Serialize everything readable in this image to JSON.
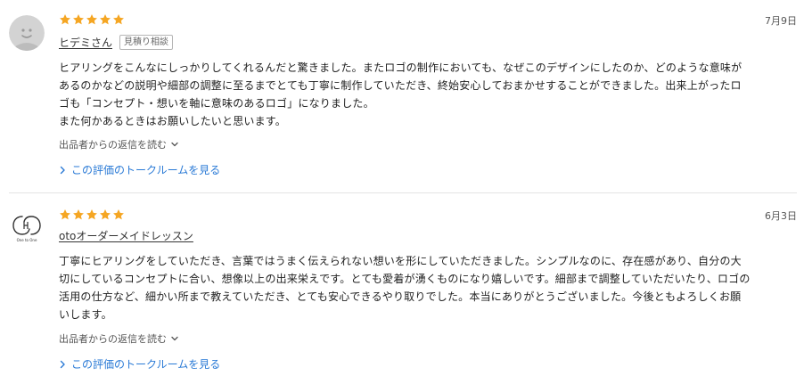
{
  "colors": {
    "star": "#f5a623",
    "link": "#2a7ad6",
    "divider": "#e4e4e4"
  },
  "reviews": [
    {
      "stars": 5,
      "date": "7月9日",
      "user_name": "ヒデミさん",
      "tag": "見積り相談",
      "avatar": "default-user-avatar-icon",
      "body_lines": [
        "ヒアリングをこんなにしっかりしてくれるんだと驚きました。またロゴの制作においても、なぜこのデザインにしたのか、どのような意味が",
        "あるのかなどの説明や細部の調整に至るまでとても丁寧に制作していただき、終始安心しておまかせすることができました。出来上がったロ",
        "ゴも「コンセプト・想いを軸に意味のあるロゴ」になりました。",
        "また何かあるときはお願いしたいと思います。"
      ],
      "reply_link": "出品者からの返信を読む",
      "talk_link": "この評価のトークルームを見る"
    },
    {
      "stars": 5,
      "date": "6月3日",
      "user_name": "otoオーダーメイドレッスン",
      "tag": "",
      "avatar": "one-to-one-logo-avatar",
      "avatar_logo_text": "One to One",
      "body_lines": [
        "丁寧にヒアリングをしていただき、言葉ではうまく伝えられない想いを形にしていただきました。シンプルなのに、存在感があり、自分の大",
        "切にしているコンセプトに合い、想像以上の出来栄えです。とても愛着が湧くものになり嬉しいです。細部まで調整していただいたり、ロゴの",
        "活用の仕方など、細かい所まで教えていただき、とても安心できるやり取りでした。本当にありがとうございました。今後ともよろしくお願",
        "いします。"
      ],
      "reply_link": "出品者からの返信を読む",
      "talk_link": "この評価のトークルームを見る"
    }
  ]
}
